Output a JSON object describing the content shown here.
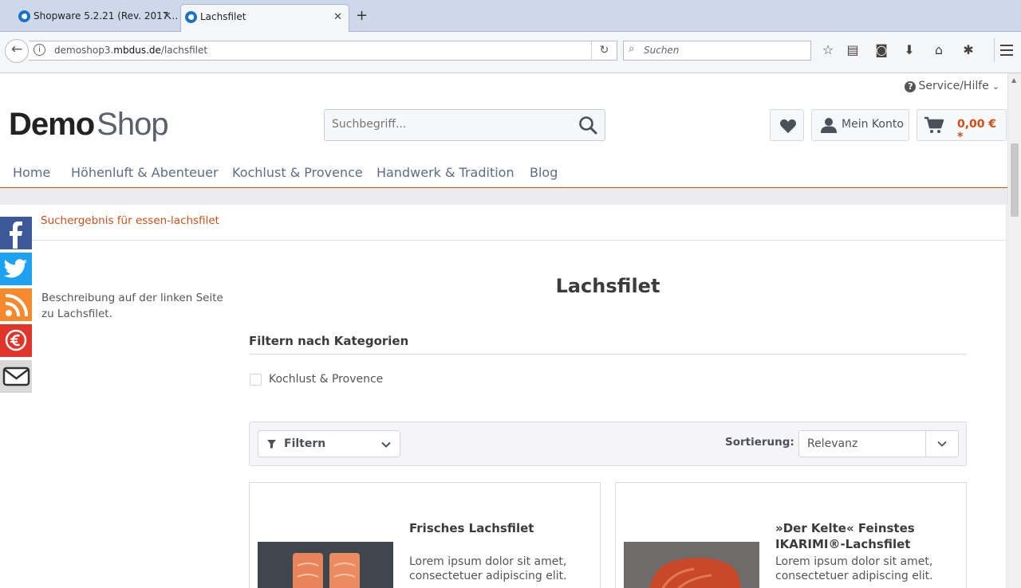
{
  "browser": {
    "tabs": [
      {
        "label": "Shopware 5.2.21 (Rev. 2017…",
        "active": false
      },
      {
        "label": "Lachsfilet",
        "active": true
      }
    ],
    "url_prefix": "demoshop3.",
    "url_host": "mbdus.de",
    "url_path": "/lachsfilet",
    "search_placeholder": "Suchen"
  },
  "header": {
    "service_label": "Service/Hilfe",
    "logo_demo": "Demo",
    "logo_shop": "Shop",
    "search_placeholder": "Suchbegriff...",
    "account_label": "Mein Konto",
    "cart_total": "0,00 € *"
  },
  "nav": {
    "items": [
      "Home",
      "Höhenluft & Abenteuer",
      "Kochlust & Provence",
      "Handwerk & Tradition",
      "Blog"
    ]
  },
  "breadcrumb": "Suchergebnis für essen-lachsfilet",
  "sidebar": {
    "description": "Beschreibung auf der linken Seite zu Lachsfilet."
  },
  "category": {
    "title": "Lachsfilet",
    "filter_heading": "Filtern nach Kategorien",
    "filter_option": "Kochlust & Provence"
  },
  "toolbar": {
    "filter_label": "Filtern",
    "sort_label": "Sortierung:",
    "sort_value": "Relevanz"
  },
  "products": [
    {
      "title": "Frisches Lachsfilet",
      "description": "Lorem ipsum dolor sit amet, consectetuer adipiscing elit."
    },
    {
      "title": "»Der Kelte« Feinstes IKARIMI®-Lachsfilet",
      "description": "Lorem ipsum dolor sit amet, consectetuer adipiscing elit."
    }
  ],
  "colors": {
    "accent": "#d14e17",
    "nav_link": "#5b6e88",
    "facebook": "#3b5998",
    "twitter": "#1da1f2",
    "rss": "#f7892c",
    "euro": "#e0342a"
  }
}
